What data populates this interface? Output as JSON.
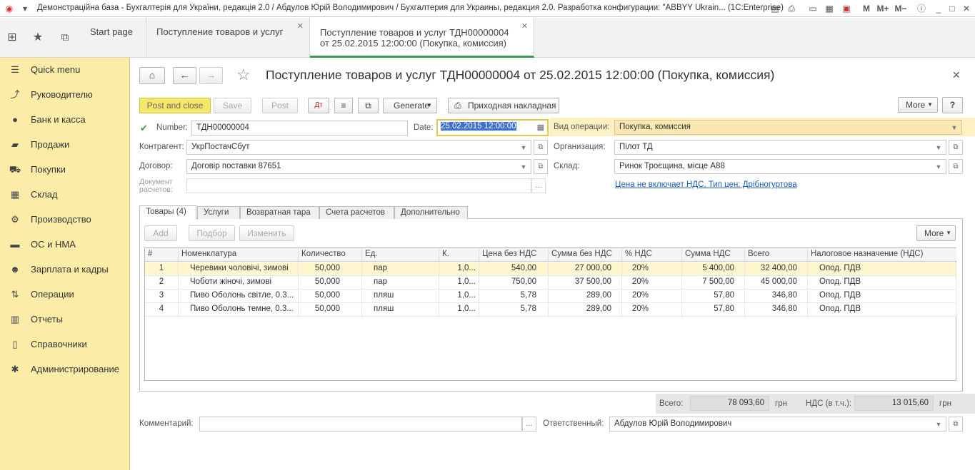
{
  "window": {
    "title": "Демонстраційна база - Бухгалтерія для України, редакція 2.0 / Абдулов Юрій Володимирович / Бухгалтерия для Украины, редакция 2.0. Разработка конфигурации: \"ABBYY Ukrain... (1C:Enterprise)",
    "m_label": "M",
    "mplus_label": "M+",
    "mminus_label": "M−"
  },
  "tabs": [
    {
      "label": "Start page"
    },
    {
      "label": "Поступление товаров и услуг"
    },
    {
      "label_line1": "Поступление товаров и услуг ТДН00000004",
      "label_line2": "от 25.02.2015 12:00:00 (Покупка, комиссия)"
    }
  ],
  "sidebar": {
    "items": [
      {
        "label": "Quick menu"
      },
      {
        "label": "Руководителю"
      },
      {
        "label": "Банк и касса"
      },
      {
        "label": "Продажи"
      },
      {
        "label": "Покупки"
      },
      {
        "label": "Склад"
      },
      {
        "label": "Производство"
      },
      {
        "label": "ОС и НМА"
      },
      {
        "label": "Зарплата и кадры"
      },
      {
        "label": "Операции"
      },
      {
        "label": "Отчеты"
      },
      {
        "label": "Справочники"
      },
      {
        "label": "Администрирование"
      }
    ]
  },
  "doc": {
    "title": "Поступление товаров и услуг ТДН00000004 от 25.02.2015 12:00:00 (Покупка, комиссия)",
    "toolbar": {
      "post_close": "Post and close",
      "save": "Save",
      "post": "Post",
      "generate": "Generate",
      "print": "Приходная накладная",
      "more": "More",
      "help": "?"
    },
    "fields": {
      "number_label": "Number:",
      "number_value": "ТДН00000004",
      "date_label": "Date:",
      "date_value": "25.02.2015 12:00:00",
      "operation_label": "Вид операции:",
      "operation_value": "Покупка, комиссия",
      "counterparty_label": "Контрагент:",
      "counterparty_value": "УкрПостачСбут",
      "organization_label": "Организация:",
      "organization_value": "Пілот ТД",
      "contract_label": "Договор:",
      "contract_value": "Договір поставки 87651",
      "warehouse_label": "Склад:",
      "warehouse_value": "Ринок Троєщина, місце А88",
      "settlement_label_1": "Документ",
      "settlement_label_2": "расчетов:",
      "price_link": "Цена не включает НДС, Тип цен: Дрібногуртова"
    },
    "subtabs": [
      "Товары (4)",
      "Услуги",
      "Возвратная тара",
      "Счета расчетов",
      "Дополнительно"
    ],
    "table_toolbar": {
      "add": "Add",
      "pick": "Подбор",
      "change": "Изменить",
      "more": "More"
    },
    "table": {
      "headers": [
        "#",
        "Номенклатура",
        "Количество",
        "Ед.",
        "К.",
        "Цена без НДС",
        "Сумма без НДС",
        "% НДС",
        "Сумма НДС",
        "Всего",
        "Налоговое назначение (НДС)"
      ],
      "rows": [
        [
          "1",
          "Черевики чоловічі, зимові",
          "50,000",
          "пар",
          "1,0...",
          "540,00",
          "27 000,00",
          "20%",
          "5 400,00",
          "32 400,00",
          "Опод. ПДВ"
        ],
        [
          "2",
          "Чоботи  жіночі, зимові",
          "50,000",
          "пар",
          "1,0...",
          "750,00",
          "37 500,00",
          "20%",
          "7 500,00",
          "45 000,00",
          "Опод. ПДВ"
        ],
        [
          "3",
          "Пиво Оболонь світле, 0.3...",
          "50,000",
          "пляш",
          "1,0...",
          "5,78",
          "289,00",
          "20%",
          "57,80",
          "346,80",
          "Опод. ПДВ"
        ],
        [
          "4",
          "Пиво Оболонь темне, 0.3...",
          "50,000",
          "пляш",
          "1,0...",
          "5,78",
          "289,00",
          "20%",
          "57,80",
          "346,80",
          "Опод. ПДВ"
        ]
      ]
    },
    "totals": {
      "total_label": "Всего:",
      "total_value": "78 093,60",
      "currency": "грн",
      "vat_label": "НДС (в т.ч.):",
      "vat_value": "13 015,60",
      "vat_currency": "грн"
    },
    "footer": {
      "comment_label": "Комментарий:",
      "comment_value": "",
      "responsible_label": "Ответственный:",
      "responsible_value": "Абдулов Юрій Володимирович"
    }
  },
  "colors": {
    "sidebar_bg": "#fbeca7",
    "active_tab_accent": "#3a9a52",
    "primary_button": "#f6e66a",
    "selected_row": "#fdf6cf"
  }
}
